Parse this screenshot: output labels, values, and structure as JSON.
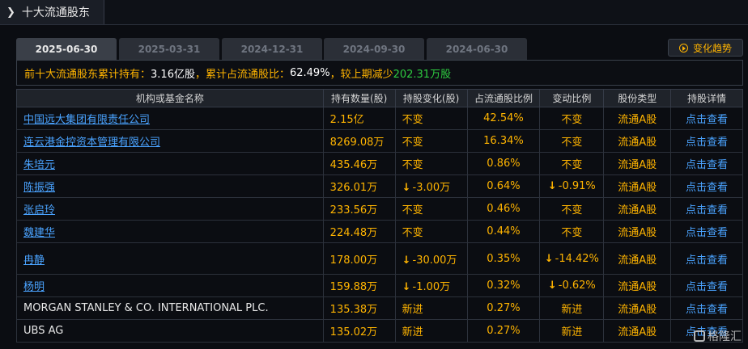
{
  "title": "十大流通股东",
  "tabs": [
    "2025-06-30",
    "2025-03-31",
    "2024-12-31",
    "2024-09-30",
    "2024-06-30"
  ],
  "active_tab": 0,
  "trend_button": "变化趋势",
  "summary": {
    "prefix": "前十大流通股东累计持有：",
    "total": "3.16亿股",
    "sep1": "，累计占流通股比：",
    "ratio": "62.49%",
    "sep2": "，较上期减少",
    "change": "202.31万股"
  },
  "columns": [
    "机构或基金名称",
    "持有数量(股)",
    "持股变化(股)",
    "占流通股比例",
    "变动比例",
    "股份类型",
    "持股详情"
  ],
  "rows": [
    {
      "name": "中国远大集团有限责任公司",
      "link": true,
      "qty": "2.15亿",
      "chg": "不变",
      "chg_type": "none",
      "pct": "42.54%",
      "var": "不变",
      "var_type": "none",
      "type": "流通A股",
      "detail": "点击查看"
    },
    {
      "name": "连云港金控资本管理有限公司",
      "link": true,
      "qty": "8269.08万",
      "chg": "不变",
      "chg_type": "none",
      "pct": "16.34%",
      "var": "不变",
      "var_type": "none",
      "type": "流通A股",
      "detail": "点击查看"
    },
    {
      "name": "朱培元",
      "link": true,
      "qty": "435.46万",
      "chg": "不变",
      "chg_type": "none",
      "pct": "0.86%",
      "var": "不变",
      "var_type": "none",
      "type": "流通A股",
      "detail": "点击查看"
    },
    {
      "name": "陈振强",
      "link": true,
      "qty": "326.01万",
      "chg": "-3.00万",
      "chg_type": "down",
      "pct": "0.64%",
      "var": "-0.91%",
      "var_type": "down",
      "type": "流通A股",
      "detail": "点击查看"
    },
    {
      "name": "张启玲",
      "link": true,
      "qty": "233.56万",
      "chg": "不变",
      "chg_type": "none",
      "pct": "0.46%",
      "var": "不变",
      "var_type": "none",
      "type": "流通A股",
      "detail": "点击查看"
    },
    {
      "name": "魏建华",
      "link": true,
      "qty": "224.48万",
      "chg": "不变",
      "chg_type": "none",
      "pct": "0.44%",
      "var": "不变",
      "var_type": "none",
      "type": "流通A股",
      "detail": "点击查看"
    },
    {
      "name": "冉静",
      "link": true,
      "qty": "178.00万",
      "chg": "-30.00万",
      "chg_type": "down",
      "pct": "0.35%",
      "var": "-14.42%",
      "var_type": "down",
      "type": "流通A股",
      "detail": "点击查看",
      "tall": true
    },
    {
      "name": "杨明",
      "link": true,
      "qty": "159.88万",
      "chg": "-1.00万",
      "chg_type": "down",
      "pct": "0.32%",
      "var": "-0.62%",
      "var_type": "down",
      "type": "流通A股",
      "detail": "点击查看"
    },
    {
      "name": "MORGAN STANLEY & CO. INTERNATIONAL PLC.",
      "link": false,
      "qty": "135.38万",
      "chg": "新进",
      "chg_type": "new",
      "pct": "0.27%",
      "var": "新进",
      "var_type": "new",
      "type": "流通A股",
      "detail": "点击查看"
    },
    {
      "name": "UBS AG",
      "link": false,
      "qty": "135.02万",
      "chg": "新进",
      "chg_type": "new",
      "pct": "0.27%",
      "var": "新进",
      "var_type": "new",
      "type": "流通A股",
      "detail": "点击查看"
    }
  ],
  "watermark": "格隆汇",
  "icons": {
    "title": "chevron-right-icon",
    "trend": "play-circle-icon",
    "down": "arrow-down-icon"
  },
  "colors": {
    "accent": "#ffb400",
    "link": "#4aa3ff",
    "down": "#2ecc40",
    "new": "#ff3b3b"
  }
}
